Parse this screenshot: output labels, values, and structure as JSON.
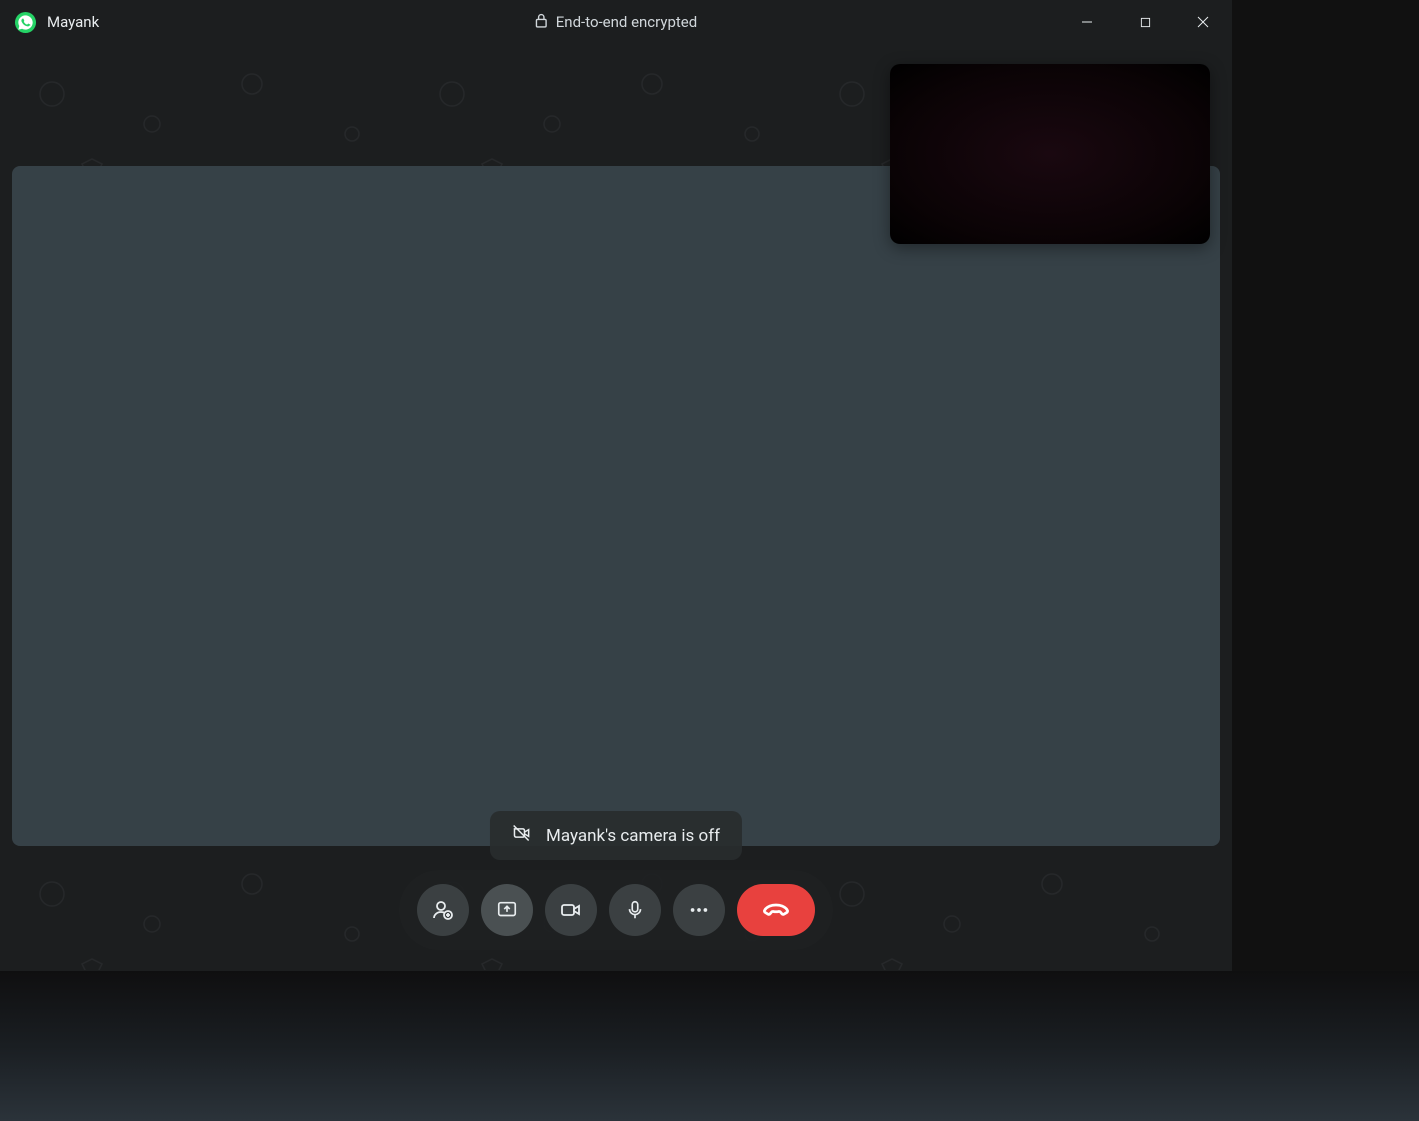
{
  "titlebar": {
    "contact_name": "Mayank",
    "encryption_label": "End-to-end encrypted"
  },
  "status": {
    "camera_off_text": "Mayank's camera is off"
  },
  "controls": {
    "add_participant": "add-participant",
    "screen_share": "screen-share",
    "camera": "camera",
    "microphone": "microphone",
    "more": "more-options",
    "end_call": "end-call"
  },
  "colors": {
    "end_call": "#e8413e",
    "video_bg": "#364147",
    "app_bg": "#1c1e1f"
  }
}
